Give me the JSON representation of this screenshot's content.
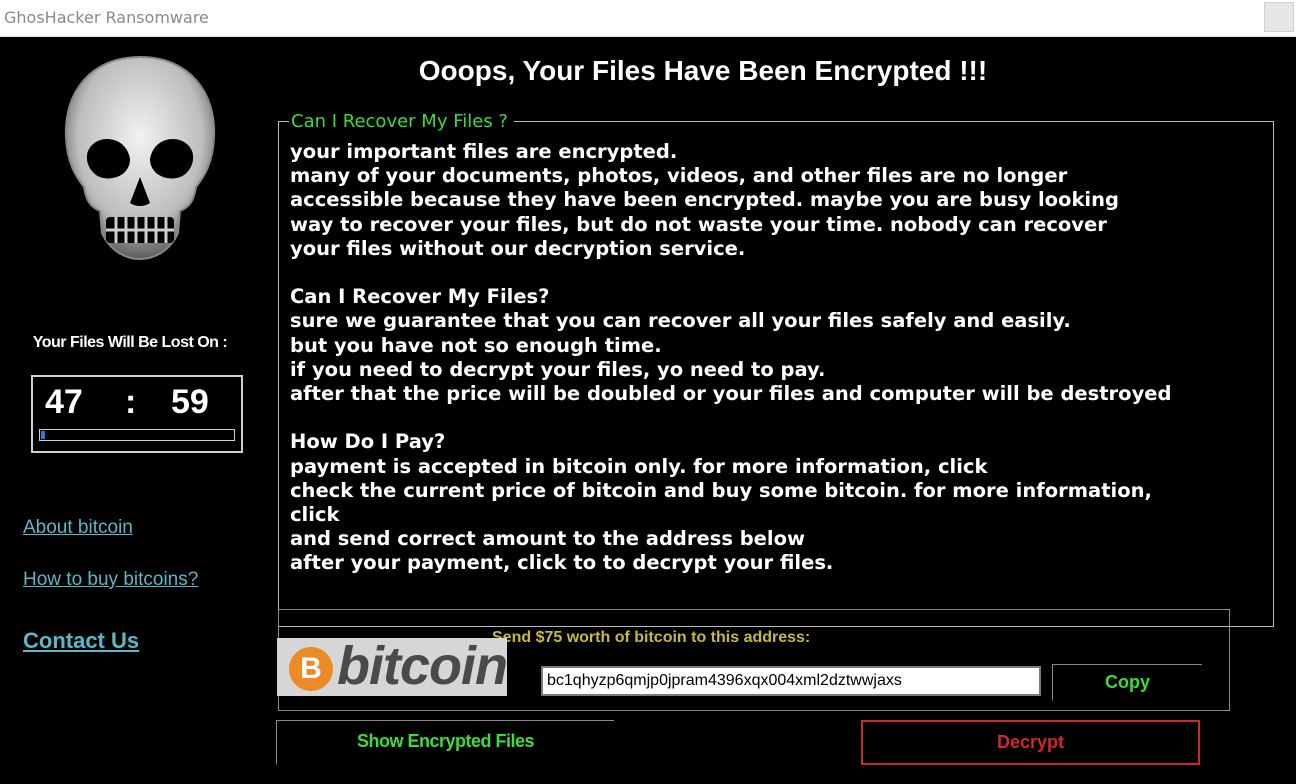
{
  "window": {
    "title": "GhosHacker Ransomware"
  },
  "sidebar": {
    "lost_label": "Your Files Will Be Lost On :",
    "timer": {
      "hours": "47",
      "separator": ":",
      "minutes": "59",
      "progress_percent": 2
    },
    "links": {
      "about_bitcoin": "About bitcoin",
      "how_to_buy": "How to buy bitcoins?",
      "contact_us": "Contact Us"
    }
  },
  "main": {
    "heading": "Ooops, Your Files Have Been Encrypted !!!",
    "group_title": "Can I Recover My Files ?",
    "message": "your important files are encrypted.\nmany of your documents, photos, videos, and other files are no longer\naccessible because they have been encrypted. maybe you are busy looking\nway to recover your files, but do not waste your time. nobody can recover\nyour files without our decryption service.\n\nCan I Recover My Files?\nsure we guarantee that you can recover all your files safely and easily.\nbut you have not so enough time.\nif you need to decrypt your files, yo need to pay.\nafter that the price will be doubled or your files and computer will be destroyed\n\nHow Do I Pay?\npayment is accepted in bitcoin only. for more information, click\ncheck the current price of bitcoin and buy some bitcoin. for more information,\nclick\nand send correct amount to the address below\nafter your payment, click to to decrypt your files."
  },
  "payment": {
    "send_label": "Send $75 worth of bitcoin to this address:",
    "logo_symbol": "B",
    "logo_word": "bitcoin",
    "address": "bc1qhyzp6qmjp0jpram4396xqx004xml2dztwwjaxs",
    "copy_label": "Copy"
  },
  "buttons": {
    "show_files": "Show Encrypted Files",
    "decrypt": "Decrypt"
  },
  "colors": {
    "background": "#000000",
    "accent_green": "#3ddc3d",
    "link_cyan": "#5bb7c8",
    "label_gold": "#c8b93a",
    "danger_red": "#d0282a",
    "progress_blue": "#2a7bd8"
  }
}
